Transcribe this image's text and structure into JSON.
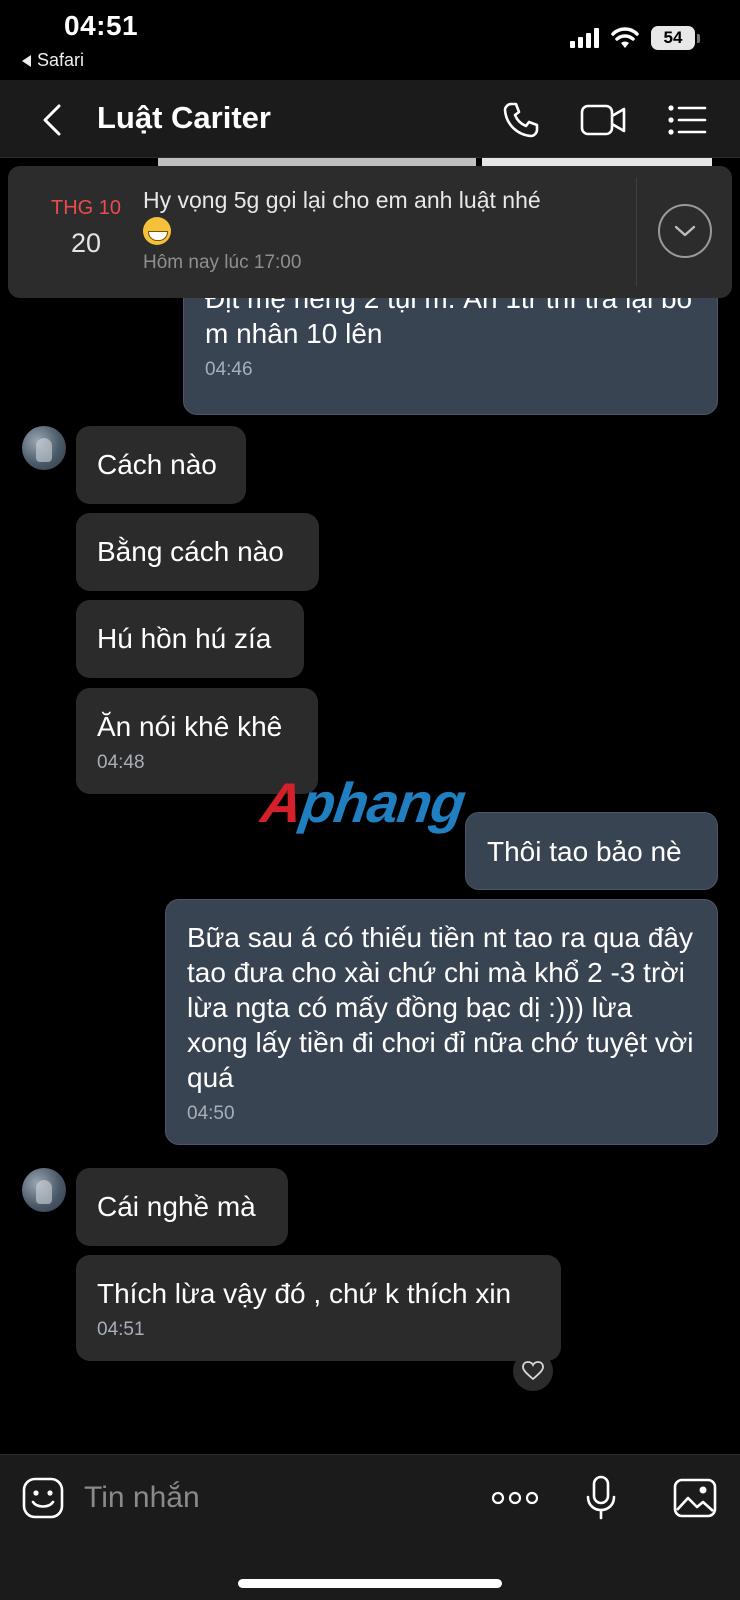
{
  "status_bar": {
    "time": "04:51",
    "back_app": "Safari",
    "battery": "54"
  },
  "header": {
    "title": "Luật Cariter"
  },
  "pinned": {
    "month": "THG 10",
    "day": "20",
    "text": "Hy vọng 5g gọi lại cho em anh luật nhé",
    "subtitle": "Hôm nay lúc 17:00"
  },
  "messages": [
    {
      "side": "out",
      "text": "Địt mẹ riêng 2 tụi m. Ăn 1tr thì trả lại bố m nhân 10 lên",
      "time": "04:46"
    },
    {
      "side": "in",
      "text": "Cách nào"
    },
    {
      "side": "in",
      "text": "Bằng cách nào"
    },
    {
      "side": "in",
      "text": "Hú hồn hú zía"
    },
    {
      "side": "in",
      "text": "Ăn nói khê khê",
      "time": "04:48"
    },
    {
      "side": "out",
      "text": "Thôi tao bảo nè"
    },
    {
      "side": "out",
      "text": "Bữa sau á có thiếu tiền nt tao ra qua đây tao đưa cho xài chứ chi mà khổ 2 -3 trời lừa ngta có mấy đồng bạc dị :))) lừa xong lấy tiền đi chơi đỉ nữa chớ tuyệt vời quá",
      "time": "04:50"
    },
    {
      "side": "in",
      "text": "Cái nghề mà"
    },
    {
      "side": "in",
      "text": "Thích lừa vậy đó , chứ k thích xin",
      "time": "04:51"
    }
  ],
  "watermark": {
    "first": "A",
    "rest": "phang"
  },
  "composer": {
    "placeholder": "Tin nhắn"
  },
  "colors": {
    "incoming_bubble": "#2b2b2b",
    "outgoing_bubble": "#394453",
    "pinned_month": "#e94c4c"
  }
}
